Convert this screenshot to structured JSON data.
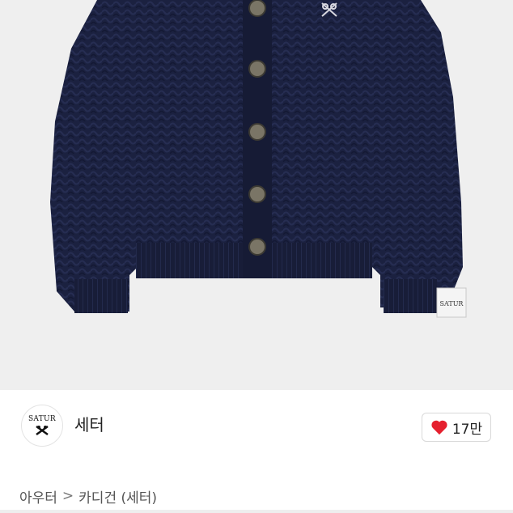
{
  "product": {
    "image_icon": "cardigan-photo",
    "sleeve_patch_text": "SATUR"
  },
  "shop": {
    "logo_text": "SATUR",
    "name": "세터"
  },
  "like": {
    "icon": "heart-icon",
    "color": "#e5202e",
    "count": "17만"
  },
  "breadcrumb": {
    "items": [
      "아우터",
      "카디건 (세터)"
    ],
    "separator": ">"
  }
}
